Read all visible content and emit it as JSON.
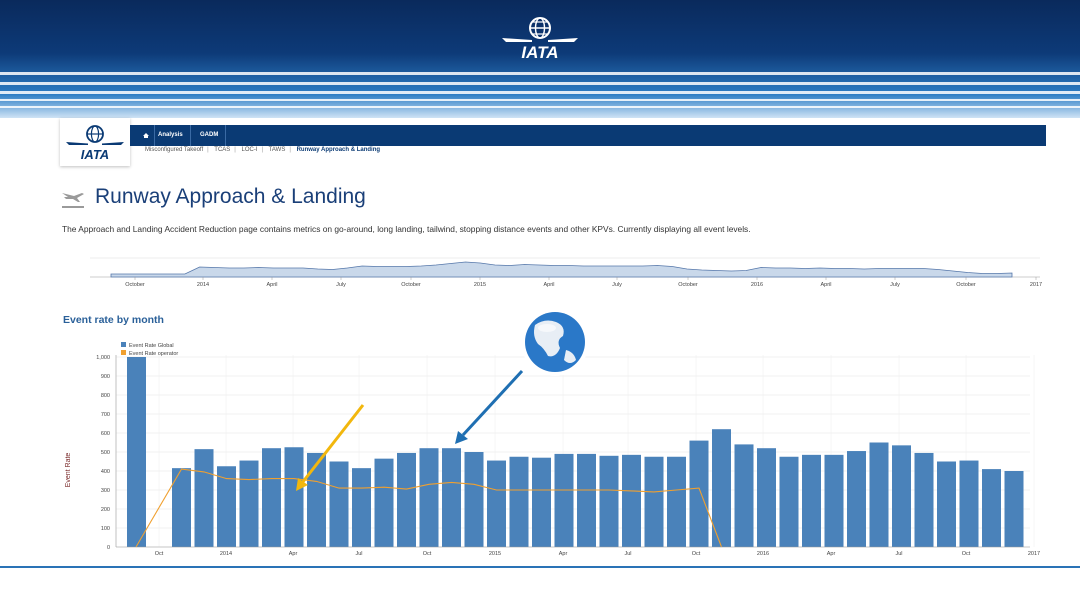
{
  "nav": {
    "items": [
      {
        "label": "Analysis"
      },
      {
        "label": "GADM"
      }
    ],
    "breadcrumbs": [
      {
        "label": "Misconfigured Takeoff"
      },
      {
        "label": "TCAS"
      },
      {
        "label": "LOC-I"
      },
      {
        "label": "TAWS"
      },
      {
        "label": "Runway Approach & Landing"
      }
    ]
  },
  "page": {
    "title": "Runway Approach & Landing",
    "description": "The Approach and Landing Accident Reduction page contains metrics on go-around, long landing, tailwind, stopping distance events and other KPVs. Currently displaying all event levels."
  },
  "navigator": {
    "tick_labels": [
      "October",
      "2014",
      "April",
      "July",
      "October",
      "2015",
      "April",
      "July",
      "October",
      "2016",
      "April",
      "July",
      "October",
      "2017"
    ],
    "profile": [
      6,
      6,
      6,
      6,
      6,
      6,
      20,
      19,
      18,
      18,
      19,
      18,
      18,
      18,
      16,
      15,
      18,
      22,
      21,
      21,
      21,
      22,
      24,
      27,
      30,
      28,
      24,
      23,
      25,
      24,
      23,
      23,
      22,
      22,
      22,
      22,
      22,
      23,
      21,
      16,
      14,
      13,
      12,
      13,
      19,
      18,
      18,
      17,
      18,
      17,
      17,
      16,
      17,
      17,
      17,
      17,
      15,
      12,
      9,
      7,
      7,
      8
    ]
  },
  "chart_data": {
    "type": "bar",
    "title": "Event rate by month",
    "ylabel": "Event Rate",
    "ylim": [
      0,
      1050
    ],
    "yticks": [
      0,
      100,
      200,
      300,
      400,
      500,
      600,
      700,
      800,
      900,
      1000
    ],
    "ytick_labels": [
      "0",
      "100",
      "200",
      "300",
      "400",
      "500",
      "600",
      "700",
      "800",
      "900",
      "1,000"
    ],
    "xtick_labels": [
      "Oct",
      "2014",
      "Apr",
      "Jul",
      "Oct",
      "2015",
      "Apr",
      "Jul",
      "Oct",
      "2016",
      "Apr",
      "Jul",
      "Oct",
      "2017"
    ],
    "legend": [
      "Event Rate Global",
      "Event Rate operator"
    ],
    "series": [
      {
        "name": "Event Rate Global",
        "color": "#4a82ba",
        "values": [
          1000,
          0,
          415,
          515,
          425,
          455,
          520,
          525,
          495,
          450,
          415,
          465,
          495,
          520,
          520,
          500,
          455,
          475,
          470,
          490,
          490,
          480,
          485,
          475,
          475,
          560,
          620,
          540,
          520,
          475,
          485,
          485,
          505,
          550,
          535,
          495,
          450,
          455,
          410,
          400
        ]
      },
      {
        "name": "Event Rate operator",
        "color": "#f0a030",
        "values": [
          0,
          null,
          410,
          395,
          360,
          355,
          360,
          360,
          345,
          310,
          310,
          315,
          305,
          330,
          340,
          330,
          300,
          300,
          300,
          300,
          300,
          300,
          295,
          290,
          300,
          310,
          0
        ]
      }
    ]
  },
  "annotations": {
    "arrow_yellow_color": "#f2b70d",
    "arrow_blue_color": "#1f6fb2",
    "globe_icon": "globe-icon"
  }
}
